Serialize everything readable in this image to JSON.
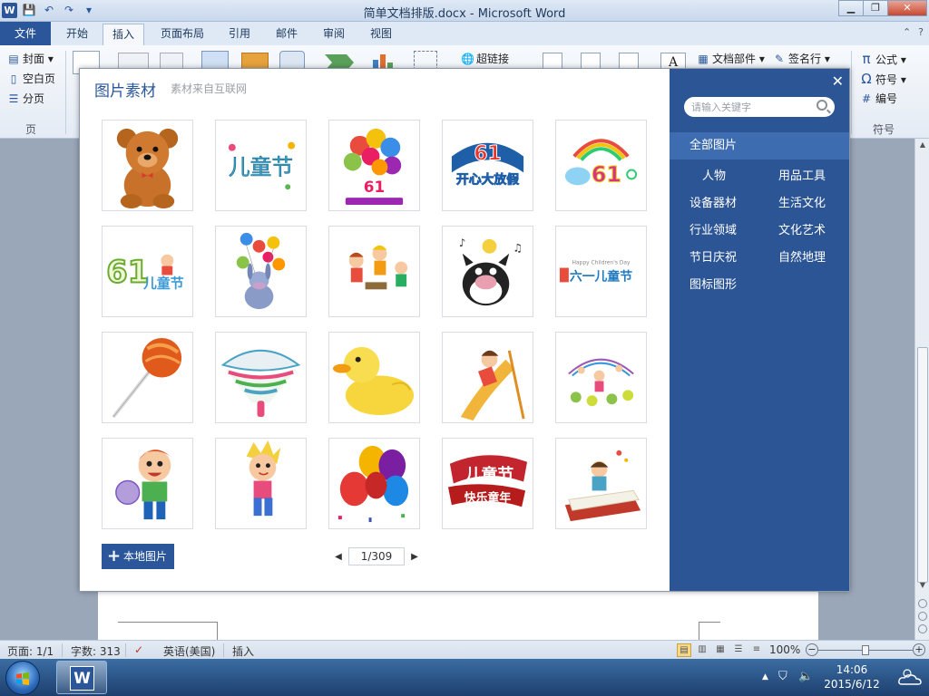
{
  "window": {
    "title": "简单文档排版.docx - Microsoft Word",
    "app_icon": "W",
    "minimize": "▁",
    "maximize": "❐",
    "close": "✕"
  },
  "qat": {
    "save": "💾",
    "undo": "↶",
    "redo": "↷",
    "more": "▾"
  },
  "tabs": [
    {
      "label": "文件"
    },
    {
      "label": "开始"
    },
    {
      "label": "插入"
    },
    {
      "label": "页面布局"
    },
    {
      "label": "引用"
    },
    {
      "label": "邮件"
    },
    {
      "label": "审阅"
    },
    {
      "label": "视图"
    }
  ],
  "ribbon": {
    "pages": {
      "cover": "封面",
      "blank": "空白页",
      "break": "分页",
      "group": "页"
    },
    "hyperlink": "超链接",
    "doc_parts": "文档部件",
    "signature": "签名行",
    "symbols": {
      "formula": "公式",
      "symbol": "符号",
      "numbering": "编号",
      "group": "符号",
      "formula_icon": "π",
      "symbol_icon": "Ω",
      "numbering_icon": "#"
    }
  },
  "dialog": {
    "title": "图片素材",
    "subtitle": "素材来自互联网",
    "close": "✕",
    "search_placeholder": "请输入关键字",
    "local_button": "本地图片",
    "local_plus": "+",
    "page_indicator": "1/309",
    "prev": "◀",
    "next": "▶",
    "category_all": "全部图片",
    "categories": [
      [
        "人物",
        "用品工具"
      ],
      [
        "设备器材",
        "生活文化"
      ],
      [
        "行业领域",
        "文化艺术"
      ],
      [
        "节日庆祝",
        "自然地理"
      ],
      [
        "图标图形",
        ""
      ]
    ],
    "thumbnails": [
      {
        "name": "teddy-bear"
      },
      {
        "name": "childrens-day-text-colorful"
      },
      {
        "name": "balloons-61"
      },
      {
        "name": "61-happy-holiday-blue"
      },
      {
        "name": "61-rainbow-logo"
      },
      {
        "name": "61-childrens-day-green"
      },
      {
        "name": "donkey-with-balloons"
      },
      {
        "name": "kids-playing-music"
      },
      {
        "name": "cartoon-cat-singing"
      },
      {
        "name": "happy-childrens-day-banner"
      },
      {
        "name": "lollipop"
      },
      {
        "name": "spinning-top"
      },
      {
        "name": "rubber-duck"
      },
      {
        "name": "kid-on-slide"
      },
      {
        "name": "kids-in-garden"
      },
      {
        "name": "boy-with-ball"
      },
      {
        "name": "boy-running"
      },
      {
        "name": "party-balloons"
      },
      {
        "name": "childrens-day-red"
      },
      {
        "name": "girl-reading-book"
      }
    ],
    "thumb_text": {
      "ertongjie": "儿童节",
      "num61": "61",
      "kaixin": "开心大放假",
      "liuyi": "六一儿童节",
      "happy_cd": "Happy Children's Day",
      "kuaile": "快乐童年"
    }
  },
  "statusbar": {
    "page": "页面: 1/1",
    "words": "字数: 313",
    "language": "英语(美国)",
    "mode": "插入",
    "zoom": "100%",
    "zoom_minus": "−",
    "zoom_plus": "+"
  },
  "taskbar": {
    "time": "14:06",
    "date": "2015/6/12",
    "word_icon": "W"
  },
  "colors": {
    "accent": "#2b579a",
    "panel": "#2c5595",
    "panel_highlight": "#3d6db0"
  }
}
